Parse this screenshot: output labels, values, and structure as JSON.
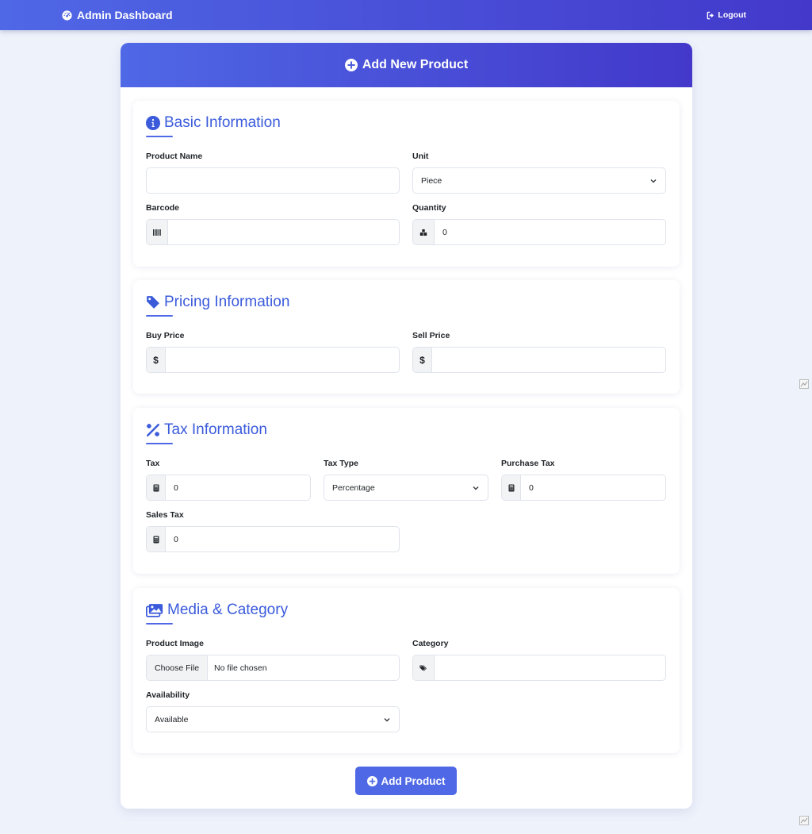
{
  "navbar": {
    "brand": "Admin Dashboard",
    "brand_icon": "gauge-icon",
    "logout": "Logout",
    "logout_icon": "sign-out-icon"
  },
  "form": {
    "header": "Add New Product",
    "header_icon": "plus-circle-icon",
    "submit_label": "Add Product"
  },
  "sections": {
    "basic": {
      "title": "Basic Information",
      "icon": "info-circle-icon",
      "product_name_label": "Product Name",
      "product_name_value": "",
      "unit_label": "Unit",
      "unit_value": "Piece",
      "barcode_label": "Barcode",
      "barcode_value": "",
      "quantity_label": "Quantity",
      "quantity_value": "0"
    },
    "pricing": {
      "title": "Pricing Information",
      "icon": "tag-icon",
      "buy_price_label": "Buy Price",
      "sell_price_label": "Sell Price",
      "currency_symbol": "$"
    },
    "tax": {
      "title": "Tax Information",
      "icon": "percent-icon",
      "tax_label": "Tax",
      "tax_value": "0",
      "tax_type_label": "Tax Type",
      "tax_type_value": "Percentage",
      "purchase_tax_label": "Purchase Tax",
      "purchase_tax_value": "0",
      "sales_tax_label": "Sales Tax",
      "sales_tax_value": "0"
    },
    "media": {
      "title": "Media & Category",
      "icon": "images-icon",
      "product_image_label": "Product Image",
      "choose_file": "Choose File",
      "no_file": "No file chosen",
      "category_label": "Category",
      "category_value": "",
      "availability_label": "Availability",
      "availability_value": "Available"
    }
  },
  "colors": {
    "primary": "#4f68e6",
    "primary_dark": "#4338ca",
    "title_blue": "#3b5bdb",
    "background": "#eef2fb"
  }
}
